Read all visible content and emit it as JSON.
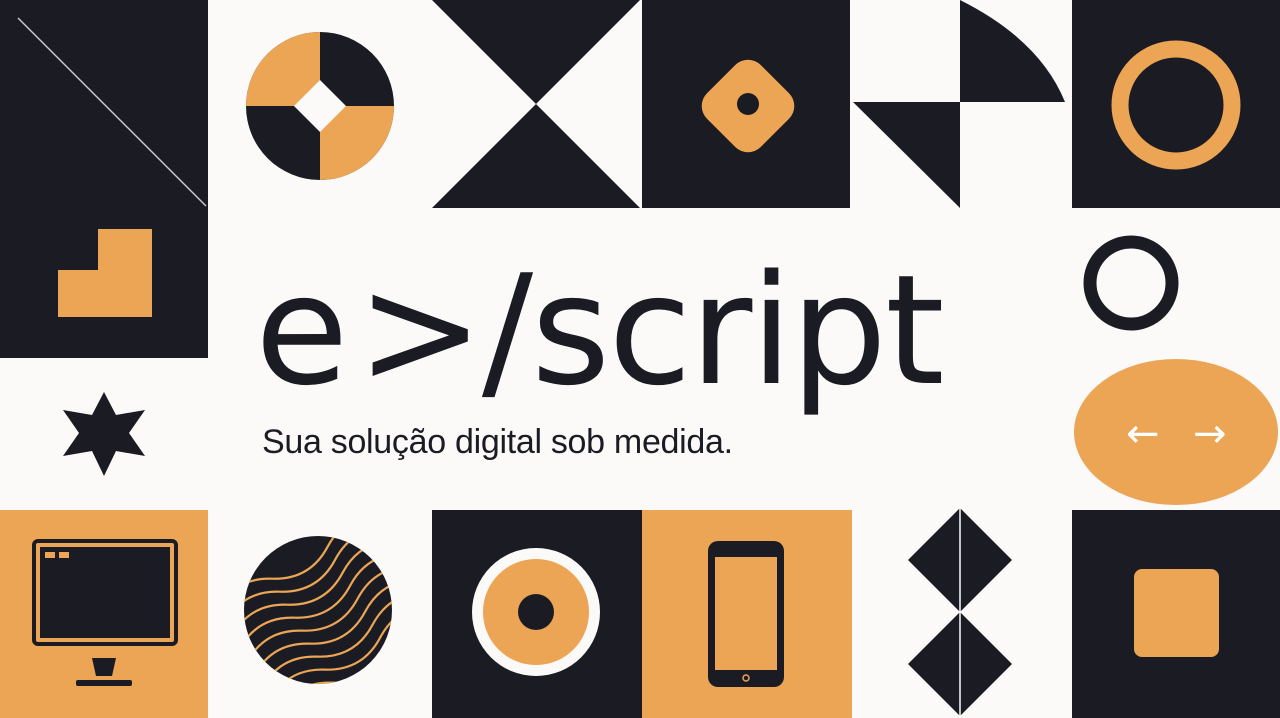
{
  "brand": {
    "wordmark_prefix": "e",
    "wordmark_bracket": ">",
    "wordmark_slash": "/",
    "wordmark_suffix": "script",
    "tagline": "Sua solução digital sob medida."
  },
  "colors": {
    "dark": "#1b1b23",
    "accent": "#eba554",
    "background": "#fbfaf9",
    "white": "#ffffff"
  },
  "arrows": {
    "left": "←",
    "right": "→"
  },
  "icons": [
    "diagonal-line-icon",
    "quartered-circle-icon",
    "hourglass-triangles-icon",
    "rounded-diamond-icon",
    "quarter-circle-triangles-icon",
    "ring-icon",
    "l-shape-icon",
    "outline-circle-icon",
    "six-point-star-icon",
    "oval-arrows-icon",
    "monitor-icon",
    "wavy-circle-icon",
    "target-circle-icon",
    "smartphone-icon",
    "stacked-diamonds-icon",
    "rounded-square-icon"
  ]
}
